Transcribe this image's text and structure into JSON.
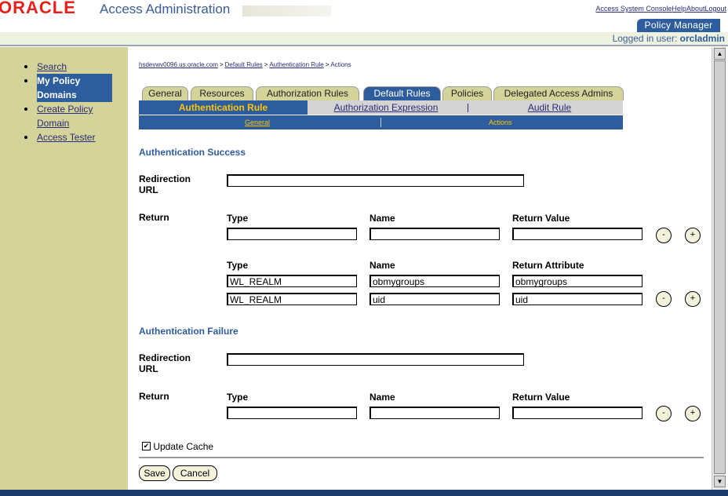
{
  "header": {
    "logo": "ORACLE",
    "title": "Access Administration",
    "links": [
      "Access System Console",
      "Help",
      "About",
      "Logout"
    ],
    "policy_manager": "Policy Manager",
    "logged_in_label": "Logged in user:",
    "logged_in_user": "orcladmin"
  },
  "sidebar": {
    "items": [
      {
        "label": "Search"
      },
      {
        "label": "My Policy Domains"
      },
      {
        "label": "Create Policy Domain"
      },
      {
        "label": "Access Tester"
      }
    ]
  },
  "breadcrumb": [
    "hsdevwv0096.us.oracle.com",
    "Default Rules",
    "Authentication Rule",
    "Actions"
  ],
  "tabs": [
    "General",
    "Resources",
    "Authorization Rules",
    "Default Rules",
    "Policies",
    "Delegated Access Admins"
  ],
  "subtabs": [
    "Authentication Rule",
    "Authorization Expression",
    "Audit Rule"
  ],
  "subsubtabs": [
    "General",
    "Actions"
  ],
  "success": {
    "title": "Authentication Success",
    "redirection_label": "Redirection URL",
    "return_label": "Return",
    "headers1": [
      "Type",
      "Name",
      "Return Value"
    ],
    "headers2": [
      "Type",
      "Name",
      "Return Attribute"
    ],
    "rows": [
      [
        "WL_REALM",
        "obmygroups",
        "obmygroups"
      ],
      [
        "WL_REALM",
        "uid",
        "uid"
      ]
    ]
  },
  "failure": {
    "title": "Authentication Failure",
    "redirection_label": "Redirection URL",
    "return_label": "Return",
    "headers": [
      "Type",
      "Name",
      "Return Value"
    ]
  },
  "update_cache": "Update Cache",
  "buttons": {
    "save": "Save",
    "cancel": "Cancel",
    "minus": "-",
    "plus": "+"
  }
}
